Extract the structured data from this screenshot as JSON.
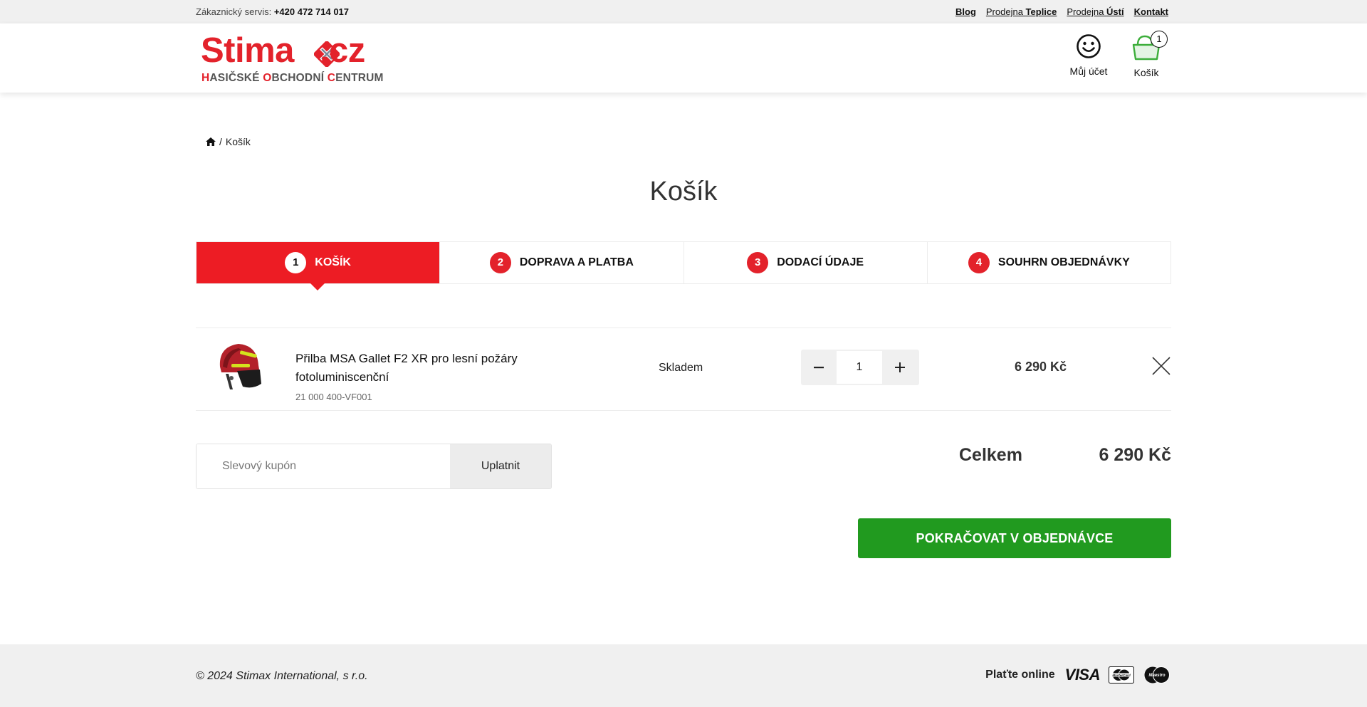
{
  "topbar": {
    "service_label": "Zákaznický servis:",
    "service_phone": "+420 472 714 017",
    "links": [
      {
        "pre": "",
        "bold": "Blog"
      },
      {
        "pre": "Prodejna ",
        "bold": "Teplice"
      },
      {
        "pre": "Prodejna ",
        "bold": "Ústí"
      },
      {
        "pre": "",
        "bold": "Kontakt"
      }
    ]
  },
  "header": {
    "logo_word": "Stimax.cz",
    "logo_tag": [
      {
        "r": "H",
        "t": "ASIČSKÉ "
      },
      {
        "r": "O",
        "t": "BCHODNÍ "
      },
      {
        "r": "C",
        "t": "ENTRUM"
      }
    ],
    "account_label": "Můj účet",
    "cart_label": "Košík",
    "cart_count": "1",
    "brand_color": "#e3222b"
  },
  "breadcrumb": {
    "current": "Košík"
  },
  "page_title": "Košík",
  "steps": [
    {
      "num": "1",
      "label": "KOŠÍK",
      "active": true
    },
    {
      "num": "2",
      "label": "DOPRAVA A PLATBA",
      "active": false
    },
    {
      "num": "3",
      "label": "DODACÍ ÚDAJE",
      "active": false
    },
    {
      "num": "4",
      "label": "SOUHRN OBJEDNÁVKY",
      "active": false
    }
  ],
  "cart_item": {
    "name": "Přilba MSA Gallet F2 XR pro lesní požáry fotoluminiscenční",
    "sku": "21 000 400-VF001",
    "availability": "Skladem",
    "quantity": "1",
    "price": "6 290 Kč"
  },
  "coupon": {
    "placeholder": "Slevový kupón",
    "apply_label": "Uplatnit"
  },
  "total": {
    "label": "Celkem",
    "value": "6 290 Kč"
  },
  "continue_label": "POKRAČOVAT V OBJEDNÁVCE",
  "footer": {
    "copyright": "© 2024 Stimax International, s r.o.",
    "pay_label": "Plaťte online",
    "visa": "VISA",
    "mastercard": "MasterCard",
    "maestro": "Maestro"
  },
  "colors": {
    "accent_red": "#ed1c24",
    "cta_green": "#219a1f"
  }
}
